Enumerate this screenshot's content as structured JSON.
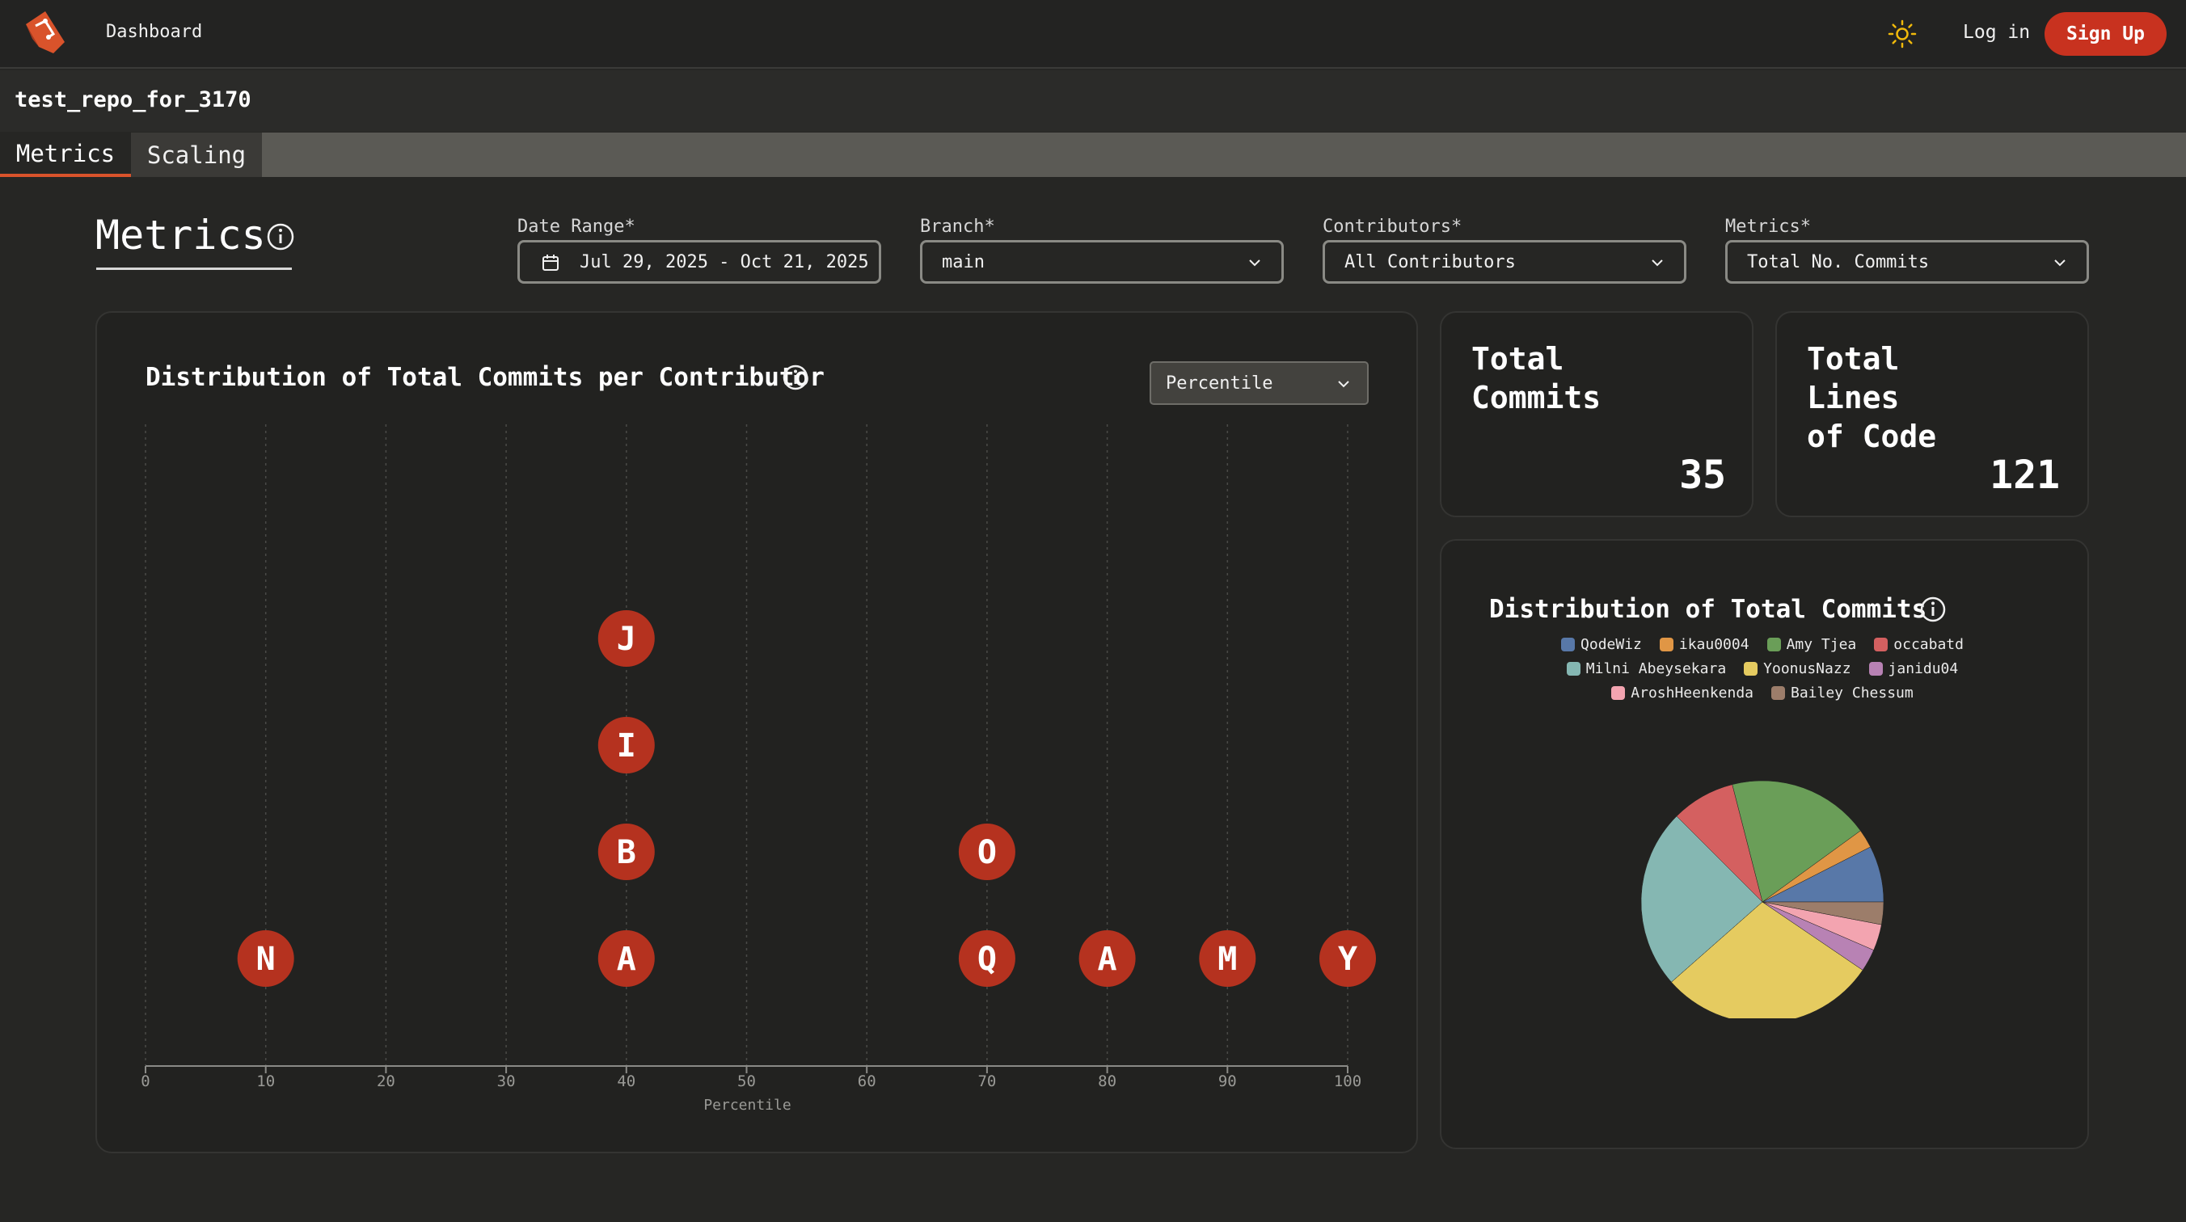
{
  "nav": {
    "dashboard_label": "Dashboard",
    "login_label": "Log in",
    "signup_label": "Sign Up",
    "theme_icon": "sun-icon",
    "accent_color": "#c8321f"
  },
  "repo": {
    "name": "test_repo_for_3170"
  },
  "tabs": [
    {
      "label": "Metrics",
      "active": true
    },
    {
      "label": "Scaling",
      "active": false
    }
  ],
  "header": {
    "title": "Metrics"
  },
  "filters": {
    "date_range": {
      "label": "Date Range*",
      "value": "Jul 29, 2025 - Oct 21, 2025"
    },
    "branch": {
      "label": "Branch*",
      "value": "main"
    },
    "contributors": {
      "label": "Contributors*",
      "value": "All Contributors"
    },
    "metrics": {
      "label": "Metrics*",
      "value": "Total No. Commits"
    }
  },
  "distribution_card": {
    "title": "Distribution of Total Commits per Contributor",
    "view_select": "Percentile"
  },
  "stats": {
    "total_commits": {
      "title_line1": "Total",
      "title_line2": "Commits",
      "value": "35"
    },
    "total_lines": {
      "title_line1": "Total",
      "title_line2": "Lines",
      "title_line3": "of Code",
      "value": "121"
    }
  },
  "pie_card": {
    "title": "Distribution of Total Commits"
  },
  "chart_data": [
    {
      "type": "scatter",
      "title": "Distribution of Total Commits per Contributor",
      "xlabel": "Percentile",
      "xlim": [
        0,
        100
      ],
      "xticks": [
        "0",
        "10",
        "20",
        "30",
        "40",
        "50",
        "60",
        "70",
        "80",
        "90",
        "100"
      ],
      "grid": true,
      "marker_color": "#b5321f",
      "points": [
        {
          "x": 10,
          "stack": 0,
          "label": "N"
        },
        {
          "x": 40,
          "stack": 0,
          "label": "A"
        },
        {
          "x": 40,
          "stack": 1,
          "label": "B"
        },
        {
          "x": 40,
          "stack": 2,
          "label": "I"
        },
        {
          "x": 40,
          "stack": 3,
          "label": "J"
        },
        {
          "x": 70,
          "stack": 0,
          "label": "Q"
        },
        {
          "x": 70,
          "stack": 1,
          "label": "O"
        },
        {
          "x": 80,
          "stack": 0,
          "label": "A"
        },
        {
          "x": 90,
          "stack": 0,
          "label": "M"
        },
        {
          "x": 100,
          "stack": 0,
          "label": "Y"
        }
      ]
    },
    {
      "type": "pie",
      "title": "Distribution of Total Commits",
      "legend": [
        [
          "QodeWiz",
          "ikau0004",
          "Amy Tjea",
          "occabatd"
        ],
        [
          "Milni Abeysekara",
          "YoonusNazz",
          "janidu04"
        ],
        [
          "AroshHeenkenda",
          "Bailey Chessum"
        ]
      ],
      "slices": [
        {
          "name": "QodeWiz",
          "value": 7.5,
          "color": "#5878a8"
        },
        {
          "name": "ikau0004",
          "value": 2.5,
          "color": "#e09645"
        },
        {
          "name": "Amy Tjea",
          "value": 19,
          "color": "#6a9e58"
        },
        {
          "name": "occabatd",
          "value": 8.5,
          "color": "#d46060"
        },
        {
          "name": "Milni Abeysekara",
          "value": 24,
          "color": "#85b7b2"
        },
        {
          "name": "YoonusNazz",
          "value": 29,
          "color": "#e5cb60"
        },
        {
          "name": "janidu04",
          "value": 3,
          "color": "#b882b4"
        },
        {
          "name": "AroshHeenkenda",
          "value": 3.5,
          "color": "#f3a4b0"
        },
        {
          "name": "Bailey Chessum",
          "value": 3,
          "color": "#9c7d6a"
        }
      ]
    }
  ]
}
